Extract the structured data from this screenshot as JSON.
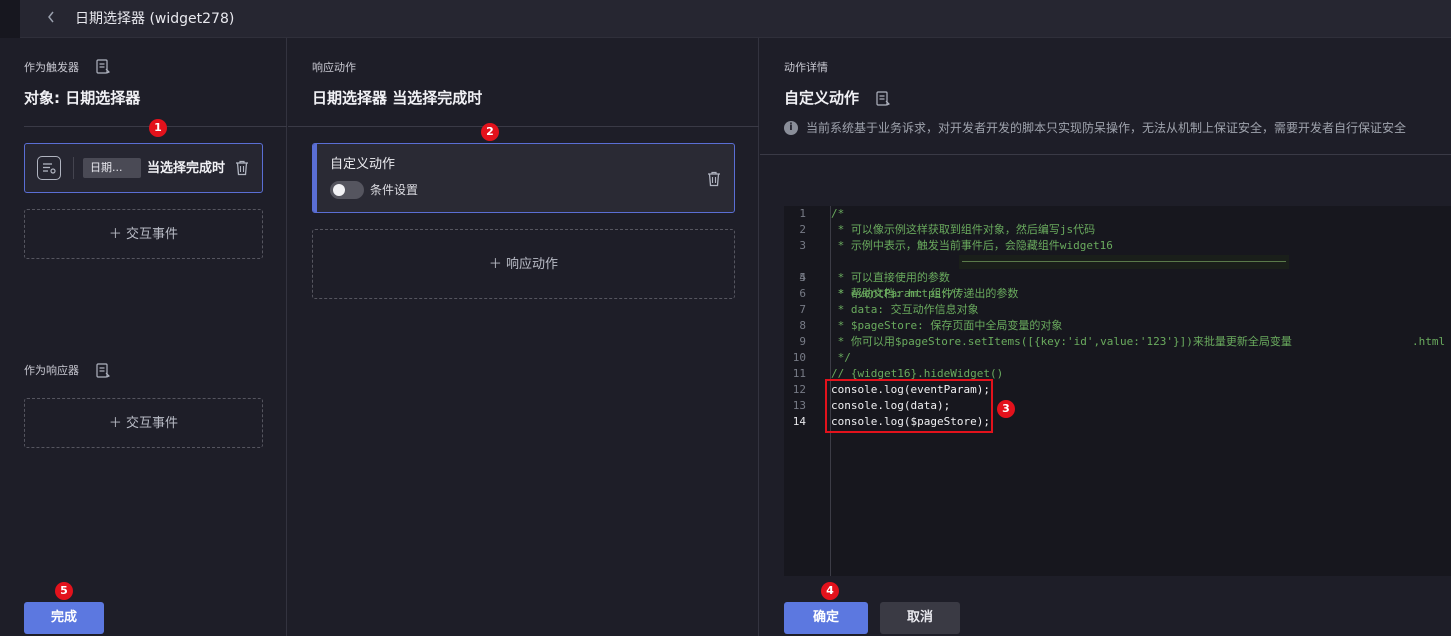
{
  "header": {
    "title": "日期选择器 (widget278)",
    "back_icon": "chevron-left-icon"
  },
  "trigger_panel": {
    "section_label": "作为触发器",
    "object_title": "对象: 日期选择器",
    "trigger_card": {
      "chip": "日期...",
      "event": "当选择完成时"
    },
    "add_event": "＋ 交互事件",
    "responder_label": "作为响应器",
    "add_responder_event": "＋ 交互事件",
    "done_button": "完成"
  },
  "action_panel": {
    "section_label": "响应动作",
    "title": "日期选择器 当选择完成时",
    "action_card": {
      "title": "自定义动作",
      "toggle_label": "条件设置",
      "toggle_on": false
    },
    "add_action": "＋ 响应动作"
  },
  "detail_panel": {
    "section_label": "动作详情",
    "title": "自定义动作",
    "notice": "当前系统基于业务诉求，对开发者开发的脚本只实现防呆操作，无法从机制上保证安全，需要开发者自行保证安全",
    "code_lines": [
      {
        "n": "1",
        "text": "/*"
      },
      {
        "n": "2",
        "text": " * 可以像示例这样获取到组件对象，然后编写js代码"
      },
      {
        "n": "3",
        "text": " * 示例中表示，触发当前事件后，会隐藏组件widget16"
      },
      {
        "n": "4",
        "text": " * 帮助文档: https://",
        "suffix": ".html"
      },
      {
        "n": "5",
        "text": " * 可以直接使用的参数"
      },
      {
        "n": "6",
        "text": " * eventParam: 组件传递出的参数"
      },
      {
        "n": "7",
        "text": " * data: 交互动作信息对象"
      },
      {
        "n": "8",
        "text": " * $pageStore: 保存页面中全局变量的对象"
      },
      {
        "n": "9",
        "text": " * 你可以用$pageStore.setItems([{key:'id',value:'123'}])来批量更新全局变量"
      },
      {
        "n": "10",
        "text": " */"
      },
      {
        "n": "11",
        "text": "// {widget16}.hideWidget()"
      },
      {
        "n": "12",
        "text": "console.log(eventParam);"
      },
      {
        "n": "13",
        "text": "console.log(data);"
      },
      {
        "n": "14",
        "text": "console.log($pageStore);"
      }
    ],
    "confirm_button": "确定",
    "cancel_button": "取消"
  },
  "badges": [
    "1",
    "2",
    "3",
    "4",
    "5"
  ],
  "colors": {
    "accent": "#5c78e0",
    "badge": "#e3121c",
    "comment": "#6aab5e"
  }
}
